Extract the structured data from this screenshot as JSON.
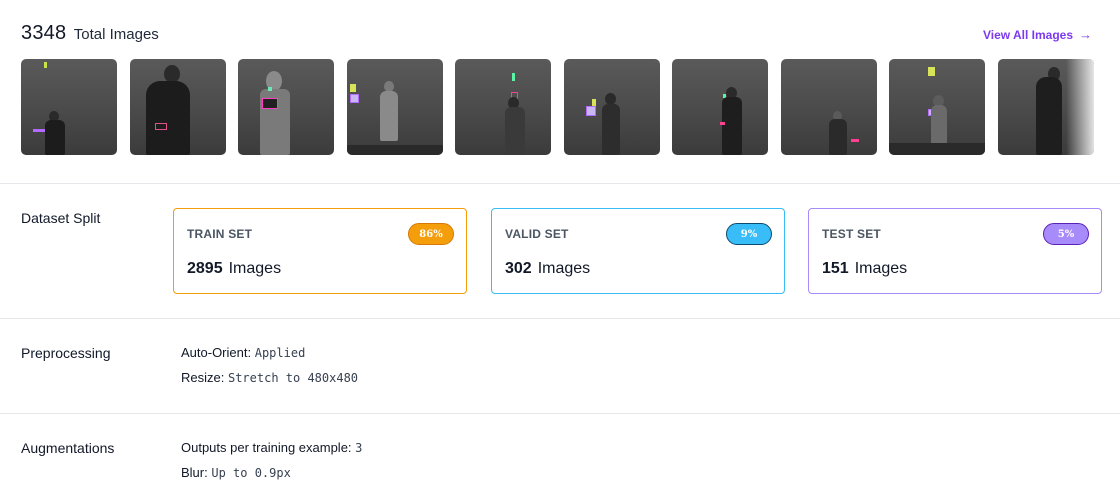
{
  "header": {
    "total_count": "3348",
    "total_label": "Total Images",
    "view_all_label": "View All Images",
    "view_all_icon": "arrow-right-icon"
  },
  "thumbnails": [
    {
      "alt": "sample-1"
    },
    {
      "alt": "sample-2"
    },
    {
      "alt": "sample-3"
    },
    {
      "alt": "sample-4"
    },
    {
      "alt": "sample-5"
    },
    {
      "alt": "sample-6"
    },
    {
      "alt": "sample-7"
    },
    {
      "alt": "sample-8"
    },
    {
      "alt": "sample-9"
    },
    {
      "alt": "sample-10"
    }
  ],
  "dataset_split": {
    "label": "Dataset Split",
    "sets": [
      {
        "title": "TRAIN SET",
        "percent": "86%",
        "count": "2895",
        "unit": "Images",
        "color": "#f59e0b"
      },
      {
        "title": "VALID SET",
        "percent": "9%",
        "count": "302",
        "unit": "Images",
        "color": "#38bdf8"
      },
      {
        "title": "TEST SET",
        "percent": "5%",
        "count": "151",
        "unit": "Images",
        "color": "#a78bfa"
      }
    ]
  },
  "preprocessing": {
    "label": "Preprocessing",
    "items": [
      {
        "key": "Auto-Orient:",
        "value": "Applied"
      },
      {
        "key": "Resize:",
        "value": "Stretch to 480x480"
      }
    ]
  },
  "augmentations": {
    "label": "Augmentations",
    "items": [
      {
        "key": "Outputs per training example:",
        "value": "3"
      },
      {
        "key": "Blur:",
        "value": "Up to 0.9px"
      }
    ]
  },
  "colors": {
    "accent": "#7c3aed",
    "train": "#f59e0b",
    "valid": "#38bdf8",
    "test": "#a78bfa"
  }
}
